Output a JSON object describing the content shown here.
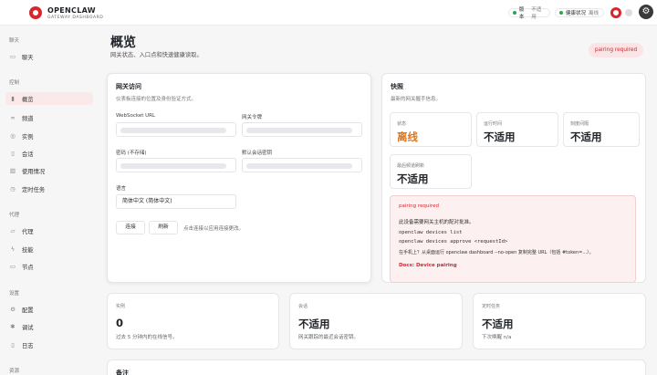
{
  "brand": {
    "name": "OPENCLAW",
    "subtitle": "GATEWAY DASHBOARD"
  },
  "header": {
    "version_label": "版本",
    "version_value": "不适用",
    "health_label": "健康状况",
    "health_value": "离线"
  },
  "sidebar": {
    "chat_section": "聊天",
    "chat_item": "聊天",
    "control_section": "控制",
    "control_items": [
      "概览",
      "频道",
      "实例",
      "会话",
      "使用情况",
      "定时任务"
    ],
    "agent_section": "代理",
    "agent_items": [
      "代理",
      "技能",
      "节点"
    ],
    "settings_section": "设置",
    "settings_items": [
      "配置",
      "调试",
      "日志"
    ],
    "resources_section": "资源"
  },
  "page": {
    "title": "概览",
    "subtitle": "网关状态、入口点和快速健康读取。",
    "pairing_badge": "pairing required"
  },
  "gateway_access": {
    "title": "网关访问",
    "desc": "仪表板连接的位置及身份验证方式。",
    "ws_label": "WebSocket URL",
    "token_label": "网关令牌",
    "password_label": "密码 (不存储)",
    "session_key_label": "默认会话密钥",
    "language_label": "语言",
    "language_value": "简体中文 (简体中文)",
    "connect_button": "连接",
    "refresh_button": "刷新",
    "hint": "点击连接以应用连接更改。"
  },
  "snapshot": {
    "title": "快照",
    "desc": "最新的网关握手信息。",
    "status_label": "状态",
    "status_value": "离线",
    "uptime_label": "运行时间",
    "uptime_value": "不适用",
    "tick_label": "刻度间隔",
    "tick_value": "不适用",
    "last_refresh_label": "最后频道刷新",
    "last_refresh_value": "不适用"
  },
  "pairing": {
    "title": "pairing required",
    "desc": "此设备需要网关主机的配对批准。",
    "cmd1": "openclaw devices list",
    "cmd2": "openclaw devices approve <requestId>",
    "note": "在手机上？从桌面运行 openclaw dashboard --no-open 复制完整 URL（包括 #token=...）。",
    "docs": "Docs: Device pairing"
  },
  "bottom": {
    "instances_label": "实例",
    "instances_value": "0",
    "instances_sub": "过去 5 分钟内的在线信号。",
    "sessions_label": "会话",
    "sessions_value": "不适用",
    "sessions_sub": "网关跟踪的最近会话密钥。",
    "cron_label": "定时任务",
    "cron_value": "不适用",
    "cron_sub_label": "下次唤醒",
    "cron_sub_value": "n/a"
  },
  "notes": {
    "title": "备注"
  },
  "colors": {
    "accent": "#d7262e",
    "offline": "#e0751a",
    "ok": "#2ea44f"
  }
}
